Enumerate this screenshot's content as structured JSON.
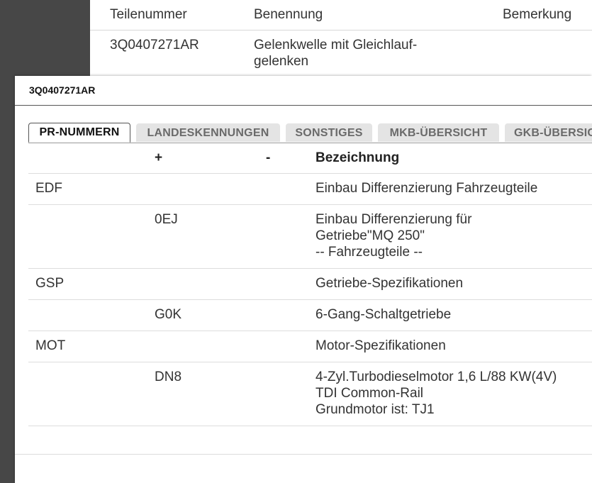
{
  "background_table": {
    "headers": {
      "part_number": "Teilenummer",
      "name": "Benennung",
      "remark": "Bemerkung"
    },
    "rows": [
      {
        "part_number": "3Q0407271AR",
        "name_line1": "Gelenkwelle mit Gleichlauf-",
        "name_line2": "gelenken",
        "remark": ""
      }
    ]
  },
  "modal": {
    "title": "3Q0407271AR",
    "tabs": [
      {
        "label": "PR-NUMMERN",
        "active": true
      },
      {
        "label": "LANDESKENNUNGEN",
        "active": false
      },
      {
        "label": "SONSTIGES",
        "active": false
      },
      {
        "label": "MKB-ÜBERSICHT",
        "active": false
      },
      {
        "label": "GKB-ÜBERSICHT",
        "active": false
      }
    ],
    "pr_table": {
      "headers": {
        "group": "",
        "plus": "+",
        "minus": "-",
        "description": "Bezeichnung"
      },
      "rows": [
        {
          "group": "EDF",
          "plus": "",
          "minus": "",
          "description": [
            "Einbau Differenzierung Fahrzeugteile"
          ]
        },
        {
          "group": "",
          "plus": "0EJ",
          "minus": "",
          "description": [
            "Einbau Differenzierung für",
            "Getriebe\"MQ 250\"",
            "-- Fahrzeugteile --"
          ]
        },
        {
          "group": "GSP",
          "plus": "",
          "minus": "",
          "description": [
            "Getriebe-Spezifikationen"
          ]
        },
        {
          "group": "",
          "plus": "G0K",
          "minus": "",
          "description": [
            "6-Gang-Schaltgetriebe"
          ]
        },
        {
          "group": "MOT",
          "plus": "",
          "minus": "",
          "description": [
            "Motor-Spezifikationen"
          ]
        },
        {
          "group": "",
          "plus": "DN8",
          "minus": "",
          "description": [
            "4-Zyl.Turbodieselmotor 1,6 L/88 KW(4V)",
            "TDI Common-Rail",
            "Grundmotor ist: TJ1"
          ]
        }
      ]
    }
  },
  "colors": {
    "backdrop": "#474747",
    "tab_inactive_bg": "#e4e4e4",
    "tab_inactive_text": "#6a6a6a",
    "text": "#333333"
  }
}
